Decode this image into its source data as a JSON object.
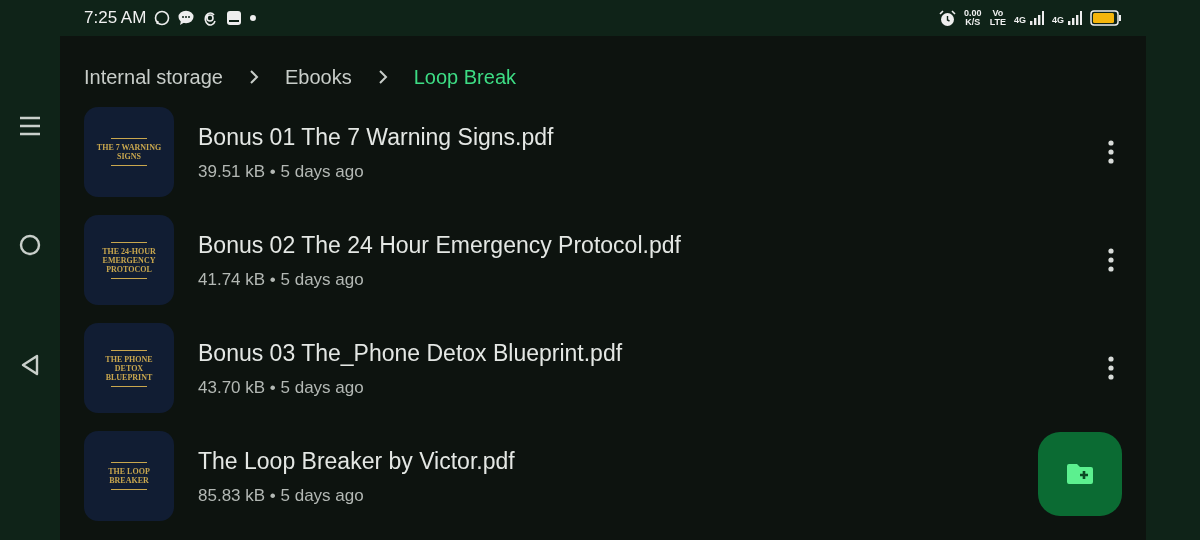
{
  "status_bar": {
    "time": "7:25 AM",
    "speed": "0.00",
    "speed_unit": "K/S",
    "volte_top": "Vo",
    "volte_bottom": "LTE",
    "sim1": "4G",
    "sim2": "4G"
  },
  "breadcrumbs": [
    {
      "label": "Internal storage",
      "selected": false
    },
    {
      "label": "Ebooks",
      "selected": false
    },
    {
      "label": "Loop Break",
      "selected": true
    }
  ],
  "files": [
    {
      "name": "Bonus 01 The 7 Warning Signs.pdf",
      "meta": "39.51 kB • 5 days ago",
      "cover": "THE 7 WARNING SIGNS",
      "menu_visible": true
    },
    {
      "name": "Bonus 02 The 24 Hour Emergency Protocol.pdf",
      "meta": "41.74 kB • 5 days ago",
      "cover": "THE 24-HOUR EMERGENCY PROTOCOL",
      "menu_visible": true
    },
    {
      "name": "Bonus 03 The_Phone Detox Blueprint.pdf",
      "meta": "43.70 kB • 5 days ago",
      "cover": "THE PHONE DETOX BLUEPRINT",
      "menu_visible": true
    },
    {
      "name": "The Loop Breaker by Victor.pdf",
      "meta": "85.83 kB • 5 days ago",
      "cover": "THE LOOP BREAKER",
      "menu_visible": false
    }
  ]
}
